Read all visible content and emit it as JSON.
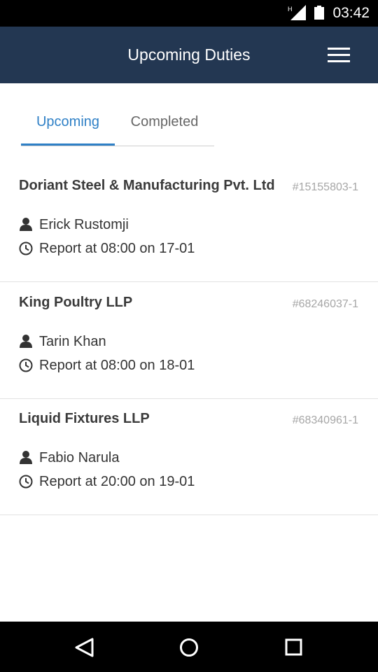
{
  "status_bar": {
    "time": "03:42",
    "network": "H"
  },
  "header": {
    "title": "Upcoming Duties",
    "menu_icon": "hamburger-menu-icon"
  },
  "tabs": [
    {
      "label": "Upcoming",
      "active": true
    },
    {
      "label": "Completed",
      "active": false
    }
  ],
  "duties": [
    {
      "company": "Doriant Steel & Manufacturing Pvt. Ltd",
      "id": "#15155803-1",
      "person": "Erick Rustomji",
      "report": "Report at 08:00 on 17-01"
    },
    {
      "company": "King Poultry LLP",
      "id": "#68246037-1",
      "person": "Tarin Khan",
      "report": "Report at 08:00 on 18-01"
    },
    {
      "company": "Liquid Fixtures LLP",
      "id": "#68340961-1",
      "person": "Fabio Narula",
      "report": "Report at 20:00 on 19-01"
    }
  ],
  "colors": {
    "header_bg": "#233752",
    "accent": "#2f80c6"
  },
  "nav_bar": {
    "back_icon": "back-triangle-icon",
    "home_icon": "home-circle-icon",
    "recents_icon": "recents-square-icon"
  }
}
